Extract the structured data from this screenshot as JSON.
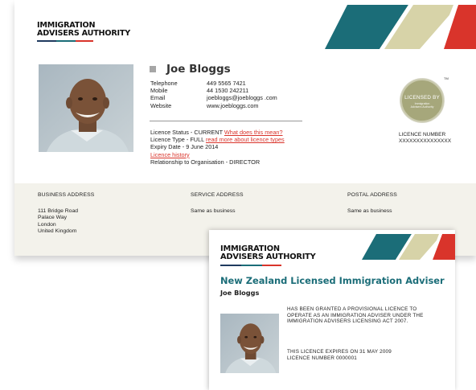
{
  "brand": {
    "logo_line1": "IMMIGRATION",
    "logo_line2": "ADVISERS AUTHORITY",
    "colors": {
      "teal": "#1b6d78",
      "khaki": "#d7d3a8",
      "red": "#d9342b",
      "navy": "#1f3a5f"
    }
  },
  "profile": {
    "name": "Joe Bloggs",
    "photo_icon": "adviser-portrait",
    "contact": [
      {
        "label": "Telephone",
        "value": "449 5565 7421"
      },
      {
        "label": "Mobile",
        "value": "44 1530 242211"
      },
      {
        "label": "Email",
        "value": "joebloggs@joebloggs .com"
      },
      {
        "label": "Website",
        "value": "www.joebloggs.com"
      }
    ],
    "licence": {
      "status_text": "Licence Status - CURRENT ",
      "status_link": "What does this mean?",
      "type_text": "Licence Type - FULL ",
      "type_link": "read more about licence types",
      "expiry": "Expiry Date - 9 June 2014",
      "history_link": "Licence history",
      "relationship": "Relationship to Organisation - DIRECTOR"
    }
  },
  "badge": {
    "line1": "LICENSED BY",
    "line2": "Immigration",
    "line3": "Advisers Authority",
    "tm": "TM"
  },
  "licence_number": {
    "label": "LICENCE NUMBER",
    "value": "XXXXXXXXXXXXXXX"
  },
  "addresses": [
    {
      "heading": "BUSINESS ADDRESS",
      "lines": [
        "111 Bridge Road",
        "Palace Way",
        "London",
        "United Kingdom"
      ]
    },
    {
      "heading": "SERVICE ADDRESS",
      "lines": [
        "Same as business"
      ]
    },
    {
      "heading": "POSTAL ADDRESS",
      "lines": [
        "Same as business"
      ]
    }
  ],
  "certificate": {
    "title": "New Zealand Licensed Immigration Adviser",
    "name": "Joe Bloggs",
    "grant_lines": [
      "HAS BEEN GRANTED A PROVISIONAL LICENCE TO",
      "OPERATE AS AN IMMIGRATION ADVISER UNDER THE",
      "IMMIGRATION ADVISERS LICENSING ACT 2007."
    ],
    "expiry_line": "THIS LICENCE EXPIRES ON 31 MAY 2009",
    "number_line": "LICENCE NUMBER 0000001"
  }
}
